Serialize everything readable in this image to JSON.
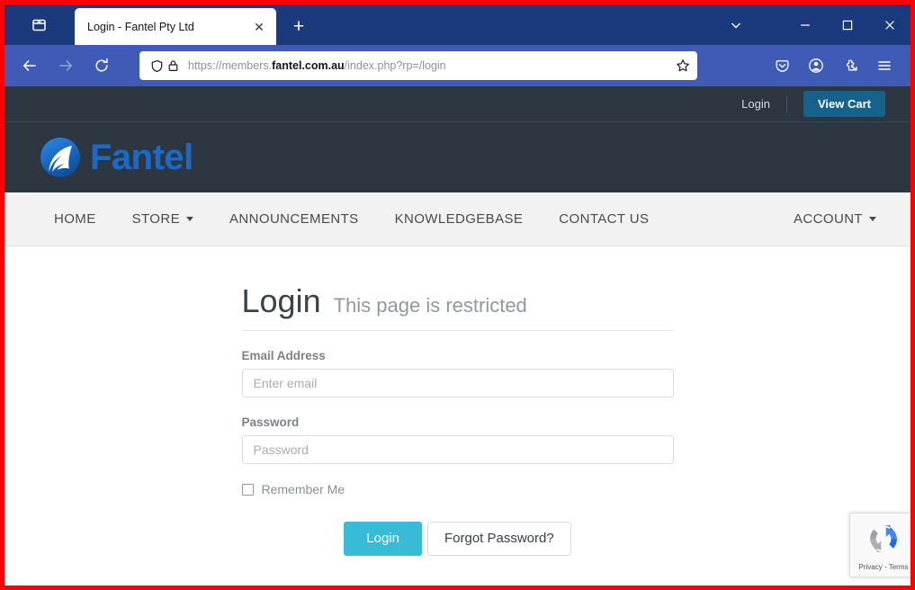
{
  "browser": {
    "tab": {
      "title": "Login - Fantel Pty Ltd",
      "close_label": "✕",
      "newtab_label": "+"
    },
    "toolbar": {
      "back_icon": "back-arrow-icon",
      "forward_icon": "forward-arrow-icon",
      "reload_icon": "reload-icon",
      "shield_icon": "shield-icon",
      "lock_icon": "lock-icon",
      "bookmark_icon": "star-icon",
      "url_prefix": "https://members.",
      "url_domain": "fantel.com.au",
      "url_suffix": "/index.php?rp=/login",
      "pocket_icon": "pocket-icon",
      "account_icon": "account-circle-icon",
      "extensions_icon": "extensions-icon",
      "menu_icon": "hamburger-menu-icon"
    },
    "window_controls": {
      "list_all_tabs": "⌄",
      "minimize": "—",
      "maximize": "□",
      "close": "✕"
    },
    "colors": {
      "tabstrip": "#1b3a7d",
      "navbar": "#3f5bb5",
      "outline": "#fe0000"
    }
  },
  "site": {
    "topbar": {
      "login_label": "Login",
      "view_cart_label": "View Cart",
      "cart_color": "#15628a",
      "bg": "#2c3742"
    },
    "header": {
      "logo_text": "Fantel",
      "logo_color": "#1b6ac9"
    },
    "nav": {
      "items": [
        {
          "label": "HOME",
          "caret": false
        },
        {
          "label": "STORE",
          "caret": true
        },
        {
          "label": "ANNOUNCEMENTS",
          "caret": false
        },
        {
          "label": "KNOWLEDGEBASE",
          "caret": false
        },
        {
          "label": "CONTACT US",
          "caret": false
        }
      ],
      "account": {
        "label": "ACCOUNT",
        "caret": true
      }
    }
  },
  "page": {
    "title": "Login",
    "subtitle": "This page is restricted",
    "email": {
      "label": "Email Address",
      "placeholder": "Enter email",
      "value": ""
    },
    "password": {
      "label": "Password",
      "placeholder": "Password",
      "value": ""
    },
    "remember": {
      "label": "Remember Me",
      "checked": false
    },
    "login_button": "Login",
    "login_button_color": "#37bbd6",
    "forgot_button": "Forgot Password?"
  },
  "recaptcha": {
    "text": "Privacy - Terms",
    "icon": "recaptcha-logo-icon"
  }
}
